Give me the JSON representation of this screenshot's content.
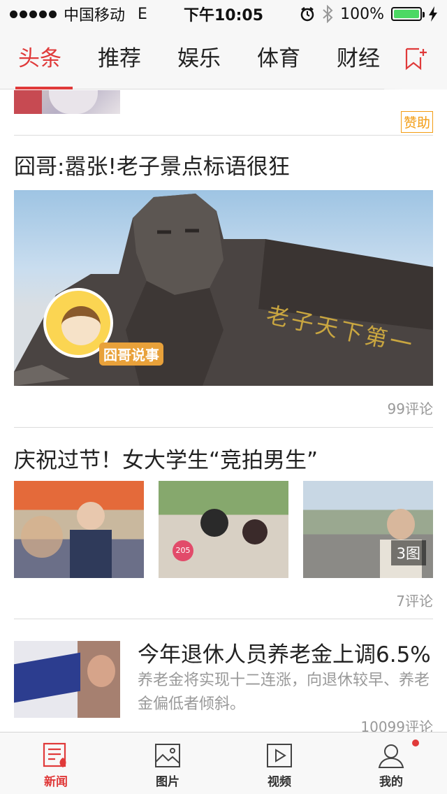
{
  "status": {
    "carrier": "中国移动",
    "network": "E",
    "time": "下午10:05",
    "battery": "100%"
  },
  "tabs": [
    {
      "label": "头条",
      "active": true
    },
    {
      "label": "推荐"
    },
    {
      "label": "娱乐"
    },
    {
      "label": "体育"
    },
    {
      "label": "财经"
    }
  ],
  "feed": {
    "ad": {
      "sponsor_label": "赞助"
    },
    "article1": {
      "title": "囧哥:嚣张!老子景点标语很狂",
      "image_caption": "老子天下第一",
      "logo_text": "囧哥说事",
      "comments": "99评论"
    },
    "article2": {
      "title": "庆祝过节！女大学生“竞拍男生”",
      "badge": "3图",
      "sign_text": "205",
      "comments": "7评论"
    },
    "article3": {
      "title": "今年退休人员养老金上调6.5%",
      "summary": "养老金将实现十二连涨，向退休较早、养老金偏低者倾斜。",
      "comments": "10099评论"
    }
  },
  "bottom_nav": [
    {
      "label": "新闻",
      "icon": "news-icon",
      "active": true
    },
    {
      "label": "图片",
      "icon": "picture-icon"
    },
    {
      "label": "视频",
      "icon": "video-icon"
    },
    {
      "label": "我的",
      "icon": "profile-icon"
    }
  ],
  "colors": {
    "accent": "#e03a3a",
    "sponsor": "#f39c12"
  }
}
